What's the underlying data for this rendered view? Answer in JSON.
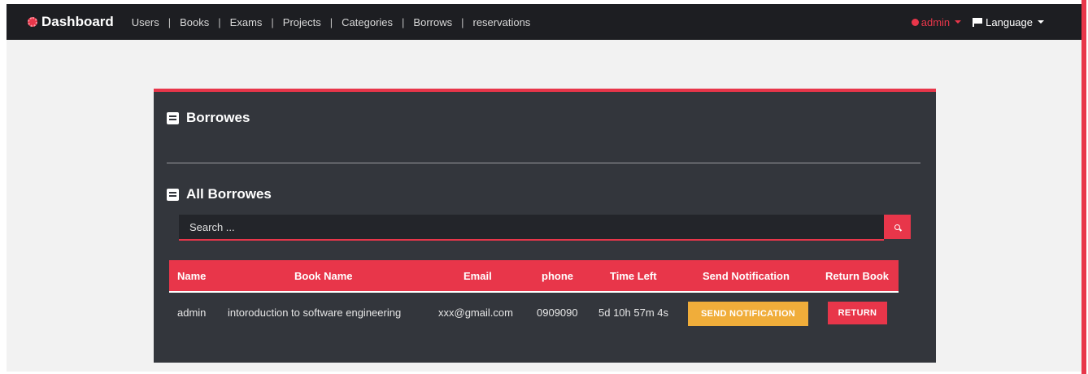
{
  "nav": {
    "brand": "Dashboard",
    "links": [
      "Users",
      "Books",
      "Exams",
      "Projects",
      "Categories",
      "Borrows",
      "reservations"
    ],
    "separator": "|",
    "user_menu": "admin",
    "language_menu": "Language"
  },
  "card": {
    "title": "Borrowes",
    "section_title": "All Borrowes"
  },
  "search": {
    "placeholder": "Search ...",
    "value": ""
  },
  "table": {
    "headers": [
      "Name",
      "Book Name",
      "Email",
      "phone",
      "Time Left",
      "Send Notification",
      "Return Book"
    ],
    "rows": [
      {
        "name": "admin",
        "book_name": "intoroduction to software engineering",
        "email": "xxx@gmail.com",
        "phone": "0909090",
        "time_left": "5d 10h 57m 4s",
        "notify_label": "SEND NOTIFICATION",
        "return_label": "RETURN"
      }
    ]
  },
  "colors": {
    "accent": "#e8364a",
    "navbar": "#1d1e22",
    "card": "#33363c",
    "warning": "#f0ad3a"
  }
}
